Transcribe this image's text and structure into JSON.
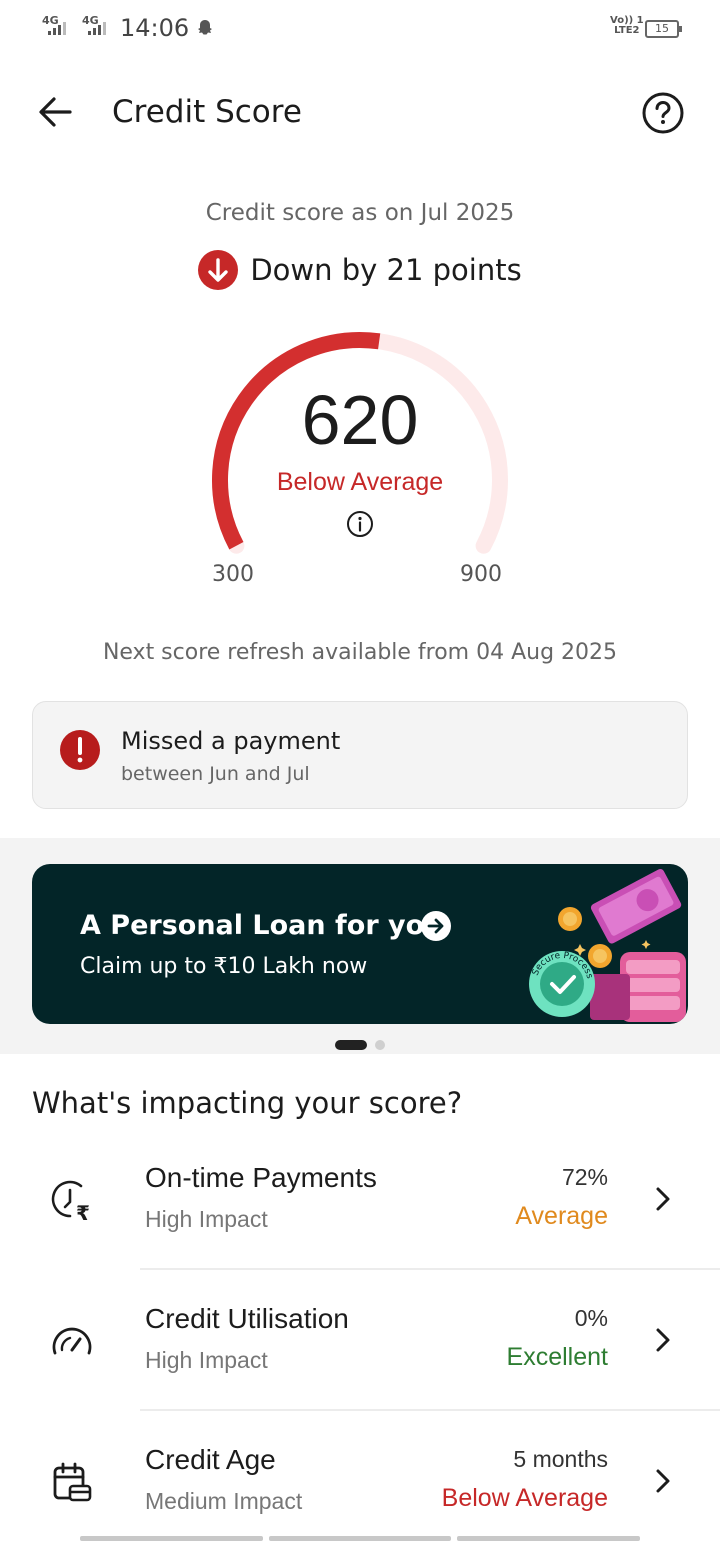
{
  "status_bar": {
    "network_1": "4G",
    "network_2": "4G",
    "time": "14:06",
    "volte_1": "Vo)) 1",
    "volte_2": "LTE2",
    "battery": "15"
  },
  "header": {
    "title": "Credit Score"
  },
  "score": {
    "as_of": "Credit score as on Jul 2025",
    "change": "Down by 21 points",
    "value": "620",
    "value_number": 620,
    "band": "Below Average",
    "range_min": "300",
    "range_max": "900",
    "refresh_note": "Next score refresh available from 04 Aug 2025"
  },
  "alert": {
    "title": "Missed a payment",
    "subtitle": "between Jun and Jul"
  },
  "banner": {
    "title": "A Personal Loan for you",
    "subtitle": "Claim up to ₹10 Lakh now",
    "badge_text": "Secure Process"
  },
  "impact": {
    "title": "What's impacting your score?",
    "factors": [
      {
        "name": "On-time Payments",
        "impact": "High Impact",
        "value": "72%",
        "status": "Average",
        "icon": "clock-rupee-icon"
      },
      {
        "name": "Credit Utilisation",
        "impact": "High Impact",
        "value": "0%",
        "status": "Excellent",
        "icon": "speedometer-icon"
      },
      {
        "name": "Credit Age",
        "impact": "Medium Impact",
        "value": "5 months",
        "status": "Below Average",
        "icon": "calendar-card-icon"
      }
    ]
  },
  "colors": {
    "accent_red": "#c62828",
    "average_orange": "#e08a1e",
    "excellent_green": "#2e7d32",
    "banner_bg": "#032528"
  }
}
